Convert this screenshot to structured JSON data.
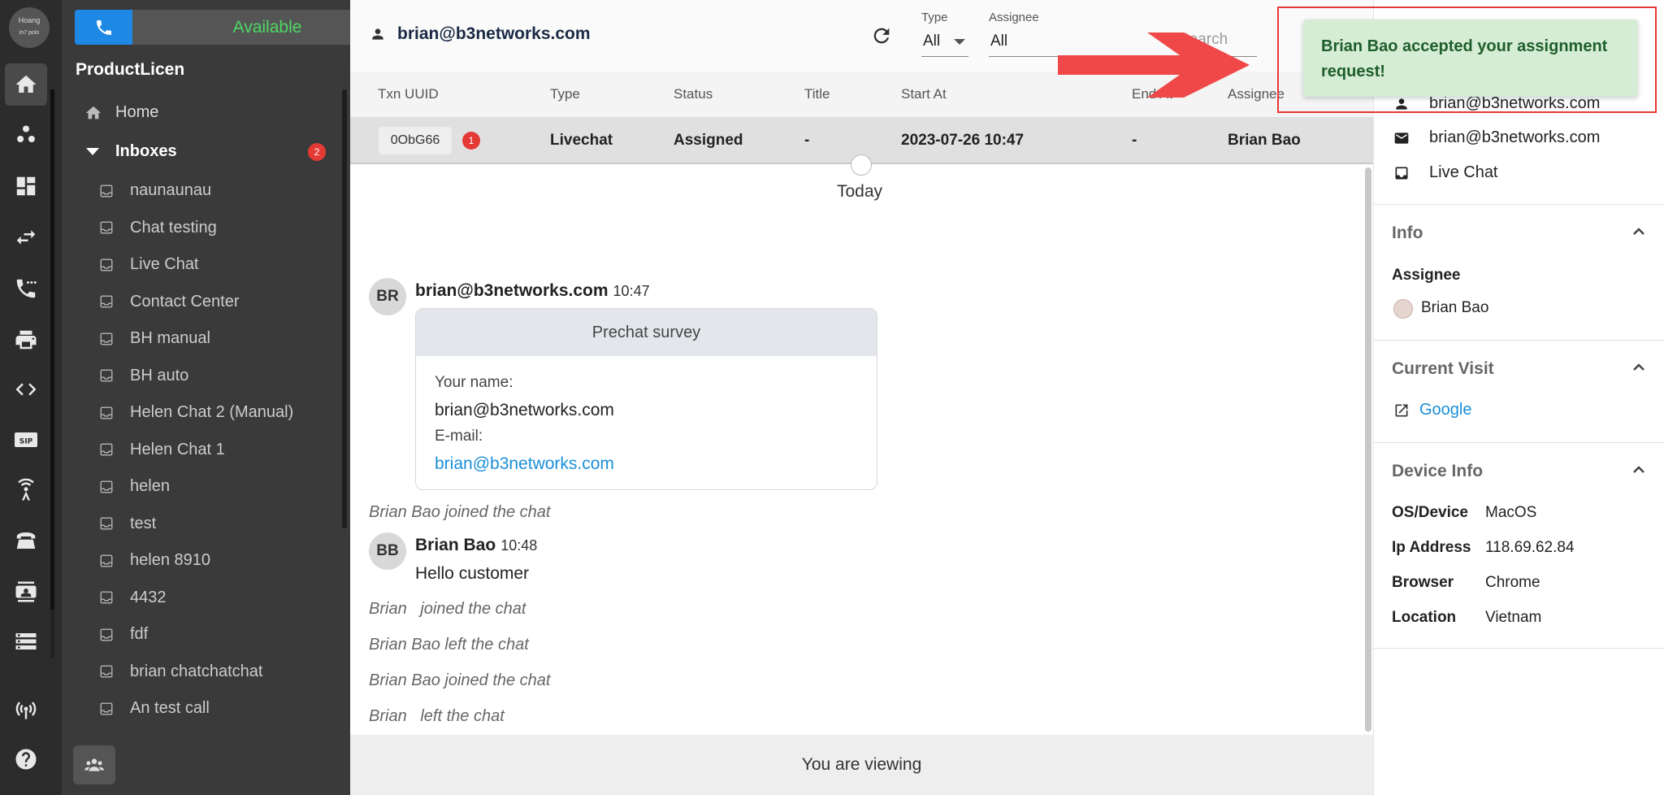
{
  "rail": {
    "avatar_text": "Hoang",
    "avatar_sub": "in7 polo"
  },
  "status": {
    "label": "Available"
  },
  "panel": {
    "org": "ProductLicen",
    "home": "Home",
    "inboxes_label": "Inboxes",
    "inboxes_badge": "2",
    "inboxes": [
      "naunaunau",
      "Chat testing",
      "Live Chat",
      "Contact Center",
      "BH manual",
      "BH auto",
      "Helen Chat 2 (Manual)",
      "Helen Chat 1",
      "helen",
      "test",
      "helen 8910",
      "4432",
      "fdf",
      "brian chatchatchat",
      "An test call"
    ]
  },
  "header": {
    "user": "brian@b3networks.com",
    "type_label": "Type",
    "type_value": "All",
    "assignee_label": "Assignee",
    "assignee_value": "All",
    "search_placeholder": "Search"
  },
  "table": {
    "columns": [
      "Txn UUID",
      "Type",
      "Status",
      "Title",
      "Start At",
      "End At",
      "Assignee"
    ],
    "row": {
      "uuid": "0ObG66",
      "uuid_badge": "1",
      "type": "Livechat",
      "status": "Assigned",
      "title": "-",
      "start_at": "2023-07-26 10:47",
      "end_at": "-",
      "assignee": "Brian Bao"
    }
  },
  "chat": {
    "date_divider": "Today",
    "msg1": {
      "initials": "BR",
      "sender": "brian@b3networks.com",
      "time": "10:47"
    },
    "survey": {
      "title": "Prechat survey",
      "name_label": "Your name:",
      "name_value": "brian@b3networks.com",
      "email_label": "E-mail:",
      "email_value": "brian@b3networks.com"
    },
    "sys1": "Brian Bao joined the chat",
    "msg2": {
      "initials": "BB",
      "sender": "Brian Bao",
      "time": "10:48",
      "text": "Hello customer"
    },
    "sys2": "Brian   joined the chat",
    "sys3": "Brian Bao left the chat",
    "sys4": "Brian Bao joined the chat",
    "sys5": "Brian   left the chat",
    "viewing": "You are viewing"
  },
  "right": {
    "contact_name": "brian@b3networks.com",
    "contact_email": "brian@b3networks.com",
    "contact_channel": "Live Chat",
    "info_title": "Info",
    "assignee_key": "Assignee",
    "assignee_value": "Brian Bao",
    "visit_title": "Current Visit",
    "visit_link": "Google",
    "device_title": "Device Info",
    "device": [
      {
        "key": "OS/Device",
        "value": "MacOS"
      },
      {
        "key": "Ip Address",
        "value": "118.69.62.84"
      },
      {
        "key": "Browser",
        "value": "Chrome"
      },
      {
        "key": "Location",
        "value": "Vietnam"
      }
    ]
  },
  "toast": {
    "message": "Brian Bao accepted your assignment request!"
  },
  "colors": {
    "primary": "#1e88e5",
    "available": "#4cd964",
    "badge": "#e53935",
    "link": "#1a8fd8",
    "toast_bg": "#d5ecd5",
    "highlight": "#e53935"
  }
}
